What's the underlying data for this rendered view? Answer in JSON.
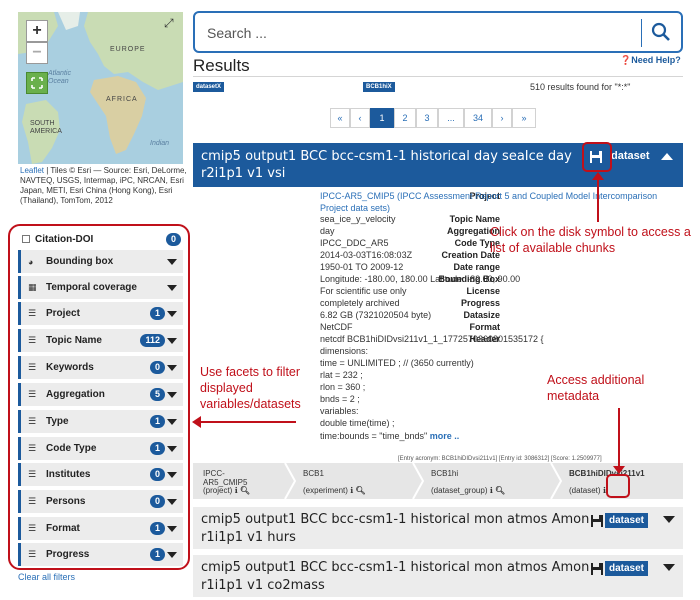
{
  "map": {
    "labels": [
      "EUROPE",
      "Atlantic Ocean",
      "AFRICA",
      "SOUTH AMERICA",
      "Indian"
    ],
    "zoom_in": "+",
    "zoom_out": "−",
    "fullscreen": "⤢",
    "credit_link": "Leaflet",
    "credit_text": " | Tiles © Esri — Source: Esri, DeLorme, NAVTEQ, USGS, Intermap, iPC, NRCAN, Esri Japan, METI, Esri China (Hong Kong), Esri (Thailand), TomTom, 2012"
  },
  "facets": {
    "citation": {
      "label": "Citation-DOI",
      "count": "0"
    },
    "items": [
      {
        "label": "Bounding box",
        "count": ""
      },
      {
        "label": "Temporal coverage",
        "count": ""
      },
      {
        "label": "Project",
        "count": "1"
      },
      {
        "label": "Topic Name",
        "count": "112"
      },
      {
        "label": "Keywords",
        "count": "0"
      },
      {
        "label": "Aggregation",
        "count": "5"
      },
      {
        "label": "Type",
        "count": "1"
      },
      {
        "label": "Code Type",
        "count": "1"
      },
      {
        "label": "Institutes",
        "count": "0"
      },
      {
        "label": "Persons",
        "count": "0"
      },
      {
        "label": "Format",
        "count": "1"
      },
      {
        "label": "Progress",
        "count": "1"
      }
    ],
    "clear_all": "Clear all filters"
  },
  "search": {
    "placeholder": "Search ..."
  },
  "results": {
    "title": "Results",
    "need_help": "Need Help?",
    "tag1": "datasetX",
    "tag2": "BCB1hiX",
    "found": "510 results found for \"*:*\""
  },
  "pagination": [
    "«",
    "‹",
    "1",
    "2",
    "3",
    "...",
    "34",
    "›",
    "»"
  ],
  "result1": {
    "title": "cmip5 output1 BCC bcc-csm1-1 historical day seaIce day r2i1p1 v1 vsi",
    "dataset_label": "dataset",
    "fields": [
      {
        "k": "Project",
        "v": "IPCC-AR5_CMIP5 (IPCC Assessment Report 5 and Coupled Model Intercomparison Project data sets)"
      },
      {
        "k": "Topic Name",
        "v": "sea_ice_y_velocity"
      },
      {
        "k": "Aggregation",
        "v": "day"
      },
      {
        "k": "Code Type",
        "v": "IPCC_DDC_AR5"
      },
      {
        "k": "Creation Date",
        "v": "2014-03-03T16:08:03Z"
      },
      {
        "k": "Date range",
        "v": "1950-01 TO 2009-12"
      },
      {
        "k": "Bounding Box",
        "v": "Longitude: -180.00, 180.00 Latitude: -82.00, 90.00"
      },
      {
        "k": "License",
        "v": "For scientific use only"
      },
      {
        "k": "Progress",
        "v": "completely archived"
      },
      {
        "k": "Datasize",
        "v": "6.82 GB (7321020504 byte)"
      },
      {
        "k": "Format",
        "v": "NetCDF"
      },
      {
        "k": "Header",
        "v": "netcdf BCB1hiDIDvsi211v1_1_1772570360801535172 {"
      }
    ],
    "header_lines": [
      "dimensions:",
      "time = UNLIMITED ; // (3650 currently)",
      "rlat = 232 ;",
      "rlon = 360 ;",
      "bnds = 2 ;",
      "variables:",
      "double time(time) ;"
    ],
    "last_line": "time:bounds = \"time_bnds\"",
    "more": "more ..",
    "entry_info": "[Entry acronym: BCB1hiDIDvsi211v1] [Entry id: 3086312] [Score: 1.2509977]"
  },
  "hierarchy": [
    {
      "title": "IPCC-AR5_CMIP5",
      "sub": "(project)"
    },
    {
      "title": "BCB1",
      "sub": "(experiment)"
    },
    {
      "title": "BCB1hi",
      "sub": "(dataset_group)"
    },
    {
      "title": "BCB1hiDIDvsi211v1",
      "sub": "(dataset)"
    }
  ],
  "result2": {
    "title": "cmip5 output1 BCC bcc-csm1-1 historical mon atmos Amon r1i1p1 v1 hurs",
    "dataset_label": "dataset"
  },
  "result3": {
    "title": "cmip5 output1 BCC bcc-csm1-1 historical mon atmos Amon r1i1p1 v1 co2mass",
    "dataset_label": "dataset"
  },
  "annotations": {
    "disk": "Click on the disk symbol to access a list of available chunks",
    "facets": "Use facets to filter displayed variables/datasets",
    "metadata": "Access additional metadata"
  },
  "colors": {
    "primary": "#1c5a9c",
    "annotation": "#c0101a",
    "link": "#2a6fb7"
  }
}
